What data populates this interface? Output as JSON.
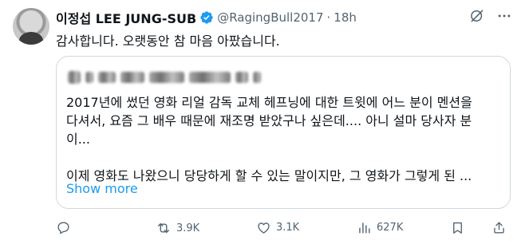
{
  "author": {
    "name": "이정섭 LEE JUNG-SUB",
    "handle": "@RagingBull2017",
    "separator": "·",
    "time": "18h"
  },
  "tweet": {
    "text": "감사합니다. 오랫동안 참 마음 아팠습니다."
  },
  "quote": {
    "lines": [
      "2017년에 썼던 영화 리얼 감독 교체 헤프닝에 대한 트윗에 어느 분이 멘션을",
      "다셔서, 요즘 그 배우 때문에 재조명 받았구나 싶은데.... 아니 설마 당사자 분",
      "이..."
    ],
    "second_paragraph": "이제 영화도 나왔으니 당당하게 할 수 있는 말이지만, 그 영화가 그렇게 된 ...",
    "show_more": "Show more"
  },
  "actions": {
    "reply_count": "",
    "retweet_count": "3.9K",
    "like_count": "3.1K",
    "views_count": "627K"
  },
  "colors": {
    "accent": "#1d9bf0",
    "secondary_text": "#536471",
    "border": "#cfd9de"
  },
  "icons": {
    "verified": "verified-badge-icon",
    "grok": "grok-icon",
    "more": "more-icon",
    "reply": "reply-icon",
    "retweet": "retweet-icon",
    "like": "heart-icon",
    "views": "views-icon",
    "bookmark": "bookmark-icon",
    "share": "share-icon"
  }
}
